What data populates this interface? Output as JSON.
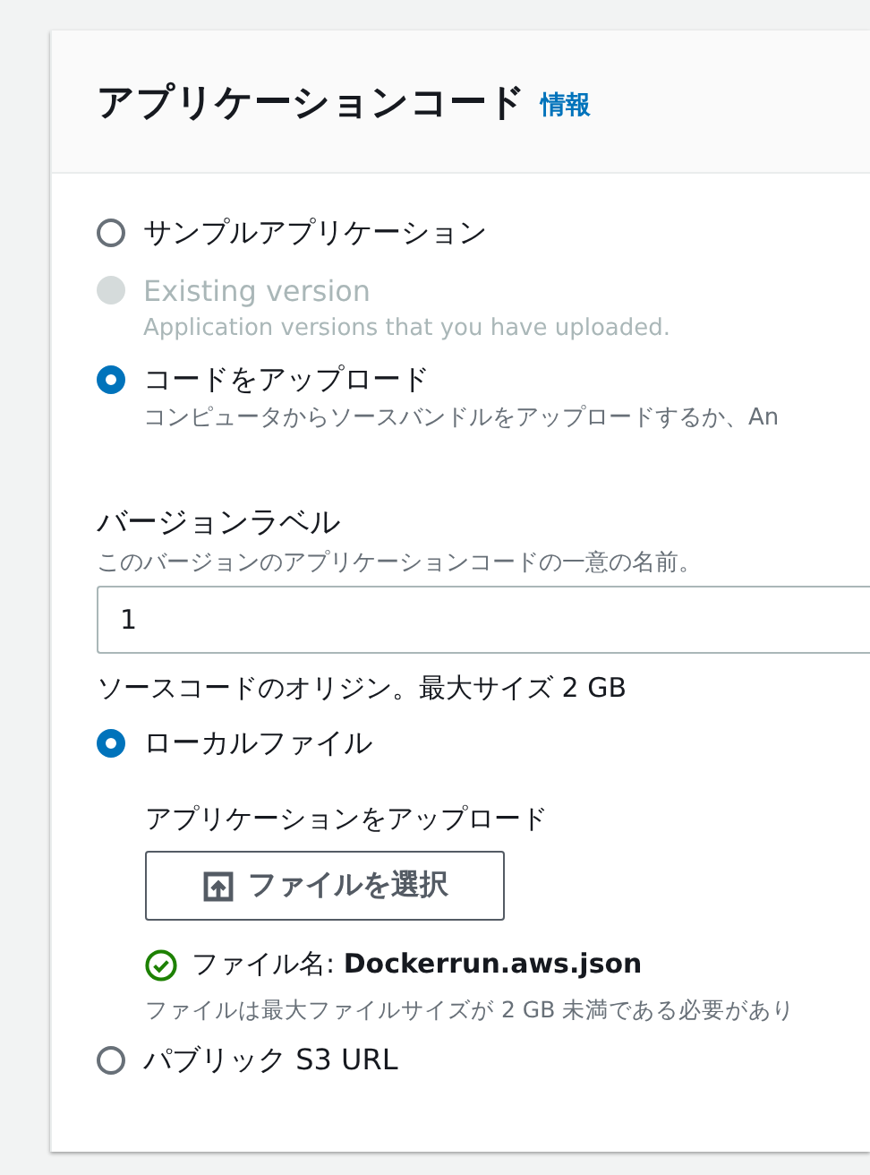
{
  "header": {
    "title": "アプリケーションコード",
    "info_link": "情報"
  },
  "source_options": [
    {
      "label": "サンプルアプリケーション",
      "selected": false,
      "disabled": false
    },
    {
      "label": "Existing version",
      "description": "Application versions that you have uploaded.",
      "selected": false,
      "disabled": true
    },
    {
      "label": "コードをアップロード",
      "description": "コンピュータからソースバンドルをアップロードするか、An",
      "selected": true,
      "disabled": false
    }
  ],
  "version_label": {
    "label": "バージョンラベル",
    "description": "このバージョンのアプリケーションコードの一意の名前。",
    "value": "1"
  },
  "origin": {
    "label": "ソースコードのオリジン。最大サイズ 2 GB",
    "options": [
      {
        "kind": "local",
        "label": "ローカルファイル",
        "selected": true,
        "upload": {
          "label": "アプリケーションをアップロード",
          "button": "ファイルを選択",
          "file_name": "ファイル名: **Dockerrun.aws.json**",
          "constraint": "ファイルは最大ファイルサイズが 2 GB 未満である必要があり"
        }
      },
      {
        "kind": "url",
        "label": "パブリック S3 URL",
        "selected": false
      }
    ]
  }
}
